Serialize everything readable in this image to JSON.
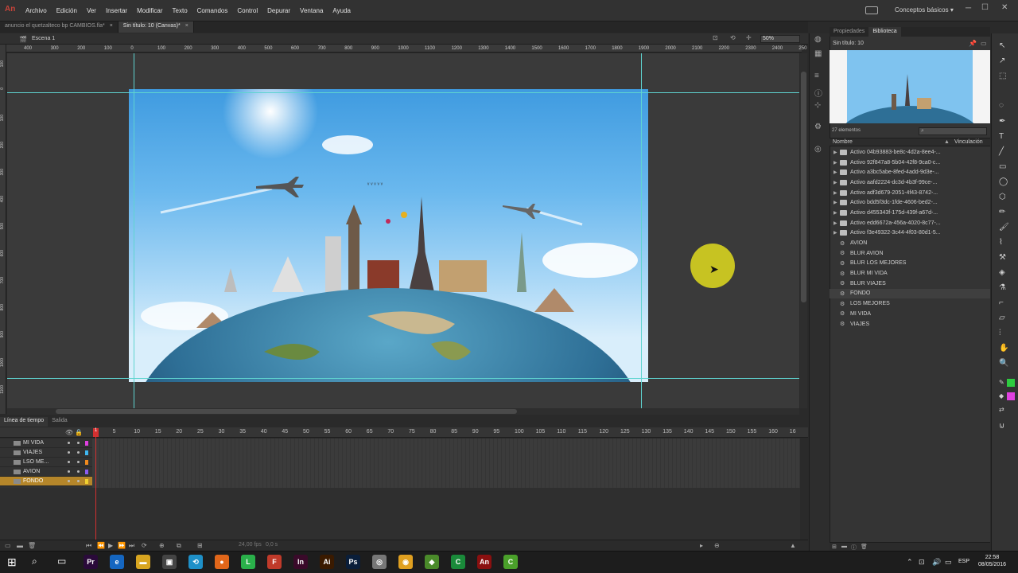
{
  "app": {
    "logo": "An"
  },
  "menu": [
    "Archivo",
    "Edición",
    "Ver",
    "Insertar",
    "Modificar",
    "Texto",
    "Comandos",
    "Control",
    "Depurar",
    "Ventana",
    "Ayuda"
  ],
  "workspace": {
    "label": "Conceptos básicos ▾"
  },
  "window": {
    "min": "─",
    "max": "☐",
    "close": "✕"
  },
  "doc_tabs": [
    {
      "label": "anuncio el quetzalteco bp CAMBIOS.fla*",
      "active": false
    },
    {
      "label": "Sin título: 10 (Canvas)*",
      "active": true
    }
  ],
  "scene": {
    "label": "Escena 1",
    "zoom": "50%"
  },
  "ruler_top": [
    "400",
    "300",
    "200",
    "100",
    "0",
    "100",
    "200",
    "300",
    "400",
    "500",
    "600",
    "700",
    "800",
    "900",
    "1000",
    "1100",
    "1200",
    "1300",
    "1400",
    "1500",
    "1600",
    "1700",
    "1800",
    "1900",
    "2000",
    "2100",
    "2200",
    "2300",
    "2400",
    "250"
  ],
  "ruler_left": [
    "100",
    "0",
    "100",
    "200",
    "300",
    "400",
    "500",
    "600",
    "700",
    "800",
    "900",
    "1000",
    "1100"
  ],
  "timeline": {
    "tabs": [
      "Línea de tiempo",
      "Salida"
    ],
    "frame_numbers": [
      "1",
      "5",
      "10",
      "15",
      "20",
      "25",
      "30",
      "35",
      "40",
      "45",
      "50",
      "55",
      "60",
      "65",
      "70",
      "75",
      "80",
      "85",
      "90",
      "95",
      "100",
      "105",
      "110",
      "115",
      "120",
      "125",
      "130",
      "135",
      "140",
      "145",
      "150",
      "155",
      "160",
      "16"
    ],
    "playhead": "1",
    "fps": "24,00 fps",
    "seconds": "0,0 s",
    "layers": [
      {
        "name": "MI VIDA",
        "color": "#e040e0",
        "selected": false
      },
      {
        "name": "VIAJES",
        "color": "#3fb6f0",
        "selected": false
      },
      {
        "name": "LSO ME...",
        "color": "#f08a1e",
        "selected": false
      },
      {
        "name": "AVION",
        "color": "#8a5cf0",
        "selected": false
      },
      {
        "name": "FONDO",
        "color": "#f0d030",
        "selected": true
      }
    ]
  },
  "library": {
    "tabs": [
      "Propiedades",
      "Biblioteca"
    ],
    "document": "Sin título: 10",
    "count": "27 elementos",
    "col_name": "Nombre",
    "col_link": "Vinculación",
    "items": [
      {
        "name": "Activo 04b93883-be8c-4d2a-8ee4-...",
        "type": "folder"
      },
      {
        "name": "Activo 92f847a8-5b04-42f8-9ca0-c...",
        "type": "folder"
      },
      {
        "name": "Activo a3bc5abe-8fed-4add-9d3e-...",
        "type": "folder"
      },
      {
        "name": "Activo aafd2224-dc3d-4b3f-99ce-...",
        "type": "folder"
      },
      {
        "name": "Activo adf3d679-2051-4f43-8742-...",
        "type": "folder"
      },
      {
        "name": "Activo bdd5f3dc-1fde-4606-bed2-...",
        "type": "folder"
      },
      {
        "name": "Activo d455343f-175d-439f-a67d-...",
        "type": "folder"
      },
      {
        "name": "Activo edd6672a-456a-4020-8c77-...",
        "type": "folder"
      },
      {
        "name": "Activo f3e49322-3c44-4f03-80d1-5...",
        "type": "folder"
      },
      {
        "name": "AVION",
        "type": "symbol"
      },
      {
        "name": "BLUR AVION",
        "type": "symbol"
      },
      {
        "name": "BLUR LOS MEJORES",
        "type": "symbol"
      },
      {
        "name": "BLUR MI VIDA",
        "type": "symbol"
      },
      {
        "name": "BLUR VIAJES",
        "type": "symbol"
      },
      {
        "name": "FONDO",
        "type": "symbol",
        "selected": true
      },
      {
        "name": "LOS MEJORES",
        "type": "symbol"
      },
      {
        "name": "MI VIDA",
        "type": "symbol"
      },
      {
        "name": "VIAJES",
        "type": "symbol"
      }
    ]
  },
  "taskbar": {
    "lang": "ESP",
    "time": "22:58",
    "date": "08/05/2016",
    "apps": [
      {
        "label": "Pr",
        "color": "#2a0a3a"
      },
      {
        "label": "e",
        "color": "#1566c0"
      },
      {
        "label": "▬",
        "color": "#d8a520"
      },
      {
        "label": "▣",
        "color": "#444"
      },
      {
        "label": "⟲",
        "color": "#1e90c8"
      },
      {
        "label": "●",
        "color": "#e0661a"
      },
      {
        "label": "L",
        "color": "#2ab04a"
      },
      {
        "label": "F",
        "color": "#c03a2a"
      },
      {
        "label": "In",
        "color": "#3a0a2a"
      },
      {
        "label": "Ai",
        "color": "#3a1a00"
      },
      {
        "label": "Ps",
        "color": "#0a1e3a"
      },
      {
        "label": "◎",
        "color": "#777"
      },
      {
        "label": "◉",
        "color": "#e0a020"
      },
      {
        "label": "◆",
        "color": "#4a8a2a"
      },
      {
        "label": "C",
        "color": "#1a8a3a"
      },
      {
        "label": "An",
        "color": "#8a1010"
      },
      {
        "label": "C",
        "color": "#4aa02a"
      }
    ]
  }
}
